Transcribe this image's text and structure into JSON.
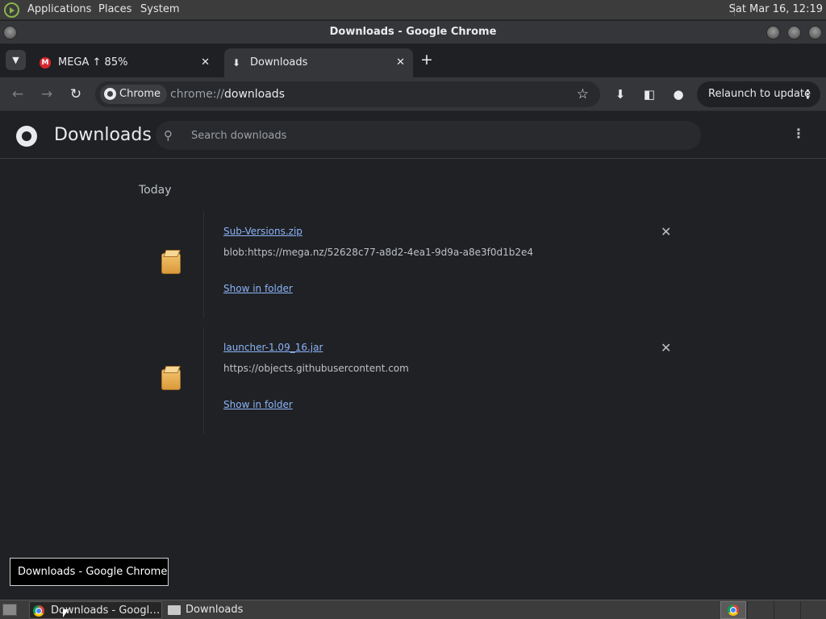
{
  "top_panel": {
    "menus": [
      "Applications",
      "Places",
      "System"
    ],
    "clock": "Sat Mar 16, 12:19"
  },
  "window": {
    "title": "Downloads - Google Chrome"
  },
  "tabs": [
    {
      "label": "MEGA ↑ 85%",
      "icon": "mega-logo-icon"
    },
    {
      "label": "Downloads",
      "icon": "download-icon",
      "active": true
    }
  ],
  "toolbar": {
    "chip_label": "Chrome",
    "url_scheme": "chrome://",
    "url_host": "downloads",
    "relaunch_label": "Relaunch to update"
  },
  "page": {
    "title": "Downloads",
    "search_placeholder": "Search downloads",
    "section": "Today",
    "items": [
      {
        "filename": "Sub-Versions.zip",
        "url": "blob:https://mega.nz/52628c77-a8d2-4ea1-9d9a-a8e3f0d1b2e4",
        "action": "Show in folder"
      },
      {
        "filename": "launcher-1.09_16.jar",
        "url": "https://objects.githubusercontent.com",
        "action": "Show in folder"
      }
    ]
  },
  "tooltip": "Downloads - Google Chrome",
  "taskbar": {
    "tasks": [
      "Downloads - Googl…",
      "Downloads"
    ]
  },
  "colors": {
    "background": "#202124",
    "link": "#8ab4f8",
    "mega_red": "#d9272e"
  }
}
